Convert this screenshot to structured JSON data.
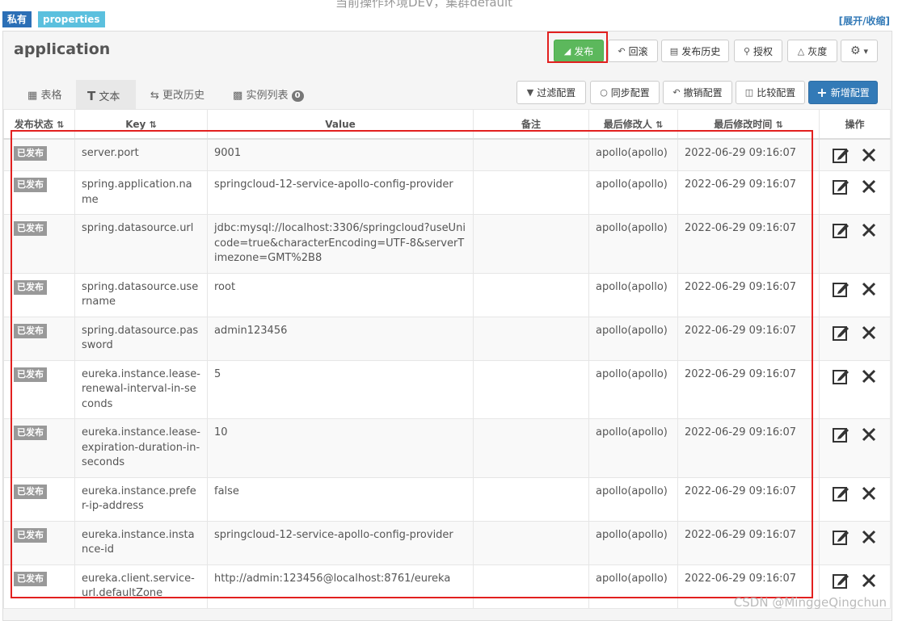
{
  "top_cut_text": "当前操作环境DEV，集群default",
  "tags": {
    "private": "私有",
    "format": "properties"
  },
  "expand_link": "[展开/收缩]",
  "namespace_title": "application",
  "toolbar": {
    "publish": "发布",
    "rollback": "回滚",
    "history": "发布历史",
    "grant": "授权",
    "gray": "灰度"
  },
  "tabs": [
    {
      "label": "表格"
    },
    {
      "label": "文本"
    },
    {
      "label": "更改历史"
    },
    {
      "label": "实例列表",
      "badge": "0"
    }
  ],
  "actions": {
    "filter": "过滤配置",
    "sync": "同步配置",
    "revoke": "撤销配置",
    "compare": "比较配置",
    "add": "新增配置"
  },
  "columns": {
    "status": "发布状态",
    "key": "Key",
    "value": "Value",
    "comment": "备注",
    "modifier": "最后修改人",
    "modified_time": "最后修改时间",
    "ops": "操作"
  },
  "rows": [
    {
      "status": "已发布",
      "key": "server.port",
      "value": "9001",
      "comment": "",
      "modifier": "apollo(apollo)",
      "time": "2022-06-29 09:16:07"
    },
    {
      "status": "已发布",
      "key": "spring.application.name",
      "value": "springcloud-12-service-apollo-config-provider",
      "comment": "",
      "modifier": "apollo(apollo)",
      "time": "2022-06-29 09:16:07"
    },
    {
      "status": "已发布",
      "key": "spring.datasource.url",
      "value": "jdbc:mysql://localhost:3306/springcloud?useUnicode=true&characterEncoding=UTF-8&serverTimezone=GMT%2B8",
      "comment": "",
      "modifier": "apollo(apollo)",
      "time": "2022-06-29 09:16:07"
    },
    {
      "status": "已发布",
      "key": "spring.datasource.username",
      "value": "root",
      "comment": "",
      "modifier": "apollo(apollo)",
      "time": "2022-06-29 09:16:07"
    },
    {
      "status": "已发布",
      "key": "spring.datasource.password",
      "value": "admin123456",
      "comment": "",
      "modifier": "apollo(apollo)",
      "time": "2022-06-29 09:16:07"
    },
    {
      "status": "已发布",
      "key": "eureka.instance.lease-renewal-interval-in-seconds",
      "value": "5",
      "comment": "",
      "modifier": "apollo(apollo)",
      "time": "2022-06-29 09:16:07"
    },
    {
      "status": "已发布",
      "key": "eureka.instance.lease-expiration-duration-in-seconds",
      "value": "10",
      "comment": "",
      "modifier": "apollo(apollo)",
      "time": "2022-06-29 09:16:07"
    },
    {
      "status": "已发布",
      "key": "eureka.instance.prefer-ip-address",
      "value": "false",
      "comment": "",
      "modifier": "apollo(apollo)",
      "time": "2022-06-29 09:16:07"
    },
    {
      "status": "已发布",
      "key": "eureka.instance.instance-id",
      "value": "springcloud-12-service-apollo-config-provider",
      "comment": "",
      "modifier": "apollo(apollo)",
      "time": "2022-06-29 09:16:07"
    },
    {
      "status": "已发布",
      "key": "eureka.client.service-url.defaultZone",
      "value": "http://admin:123456@localhost:8761/eureka",
      "comment": "",
      "modifier": "apollo(apollo)",
      "time": "2022-06-29 09:16:07"
    }
  ],
  "watermark": "CSDN @MinggeQingchun",
  "colors": {
    "highlight": "#e2201f",
    "publish_green": "#5cb85c",
    "primary_blue": "#337ab7"
  }
}
